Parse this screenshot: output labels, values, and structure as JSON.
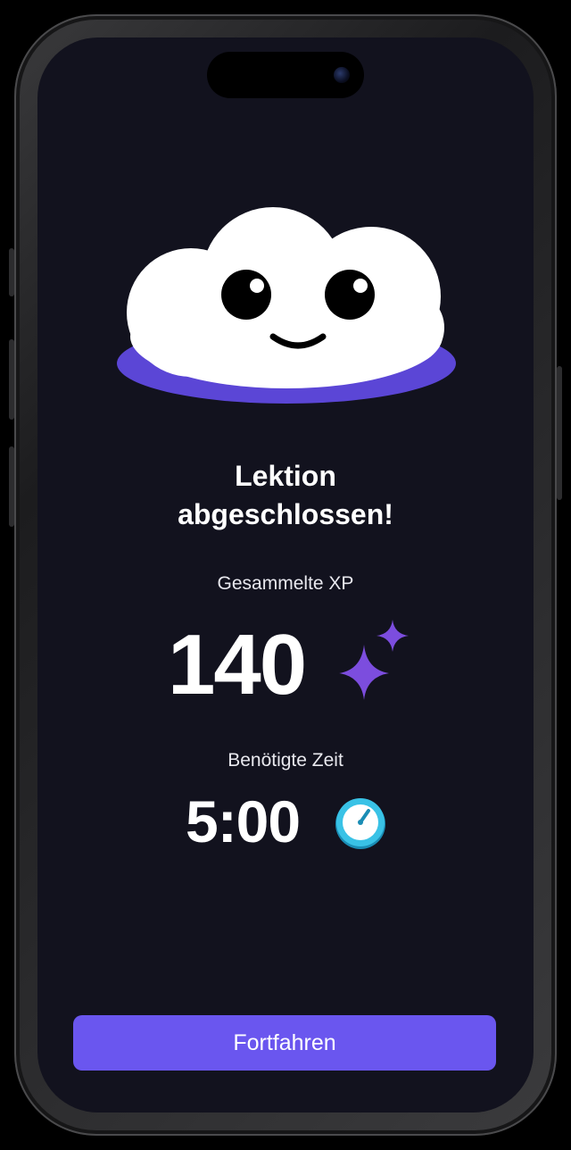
{
  "lesson_complete": {
    "title_line1": "Lektion",
    "title_line2": "abgeschlossen!",
    "xp_label": "Gesammelte XP",
    "xp_value": "140",
    "time_label": "Benötigte Zeit",
    "time_value": "5:00",
    "continue_label": "Fortfahren"
  },
  "icons": {
    "mascot": "cloud-mascot-icon",
    "xp": "sparkle-icon",
    "time": "stopwatch-icon"
  },
  "colors": {
    "background": "#12121e",
    "accent": "#6a56ef",
    "sparkle": "#7c4dde",
    "mascot_shadow": "#5b46d6",
    "timer": "#39c2e6"
  }
}
